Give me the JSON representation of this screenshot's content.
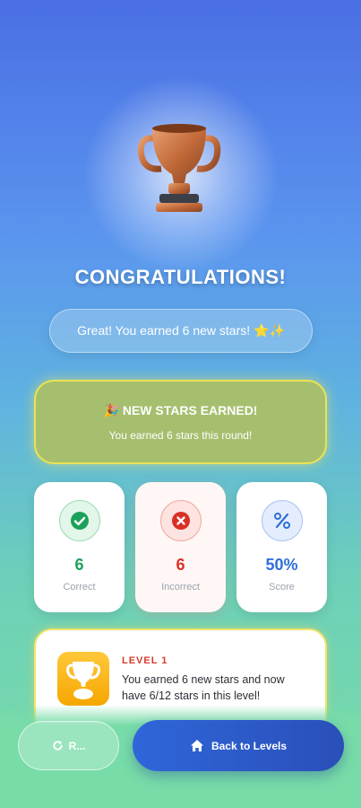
{
  "header": {
    "title": "CONGRATULATIONS!",
    "message": "Great! You earned 6 new stars! ⭐✨"
  },
  "new_stars_banner": {
    "heading": "🎉 NEW STARS EARNED!",
    "subtext": "You earned 6 stars this round!"
  },
  "stats": [
    {
      "value": "6",
      "label": "Correct",
      "icon": "check-icon",
      "color": "#1aa15a"
    },
    {
      "value": "6",
      "label": "Incorrect",
      "icon": "x-icon",
      "color": "#d93025"
    },
    {
      "value": "50%",
      "label": "Score",
      "icon": "percent-icon",
      "color": "#2f6fd8"
    }
  ],
  "level_card": {
    "label": "LEVEL 1",
    "text": "You earned 6 new stars and now have 6/12 stars in this level!"
  },
  "actions": {
    "retry_label": "R...",
    "back_label": "Back to Levels"
  },
  "colors": {
    "accent_blue": "#2f66d9",
    "banner_green": "#a6bf6e",
    "gold": "#f5a700"
  }
}
